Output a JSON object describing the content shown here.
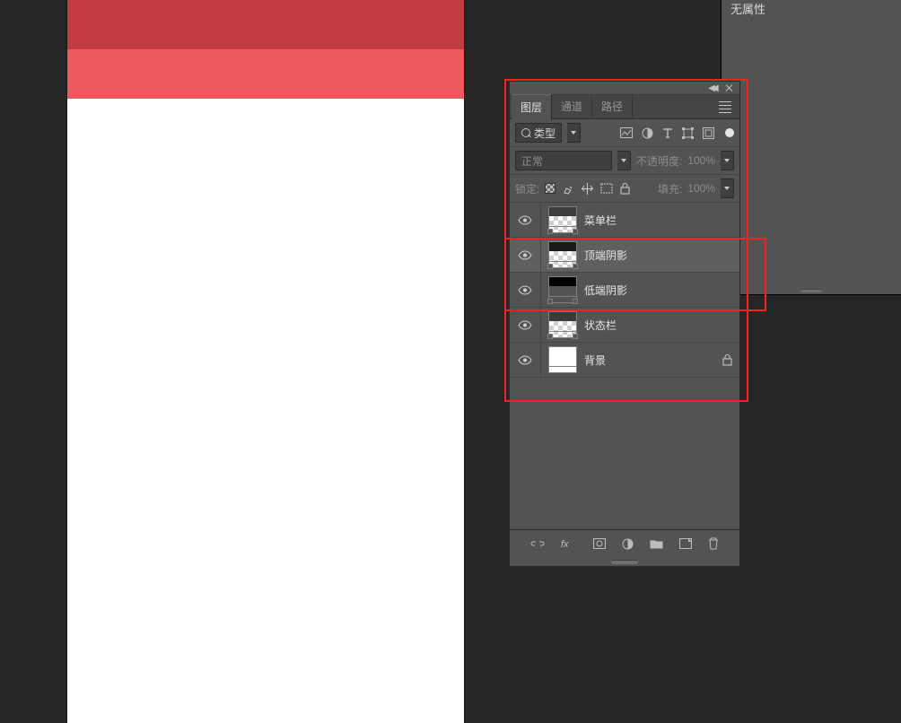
{
  "props": {
    "title": "无属性"
  },
  "tabs": {
    "layers": "图层",
    "channels": "通道",
    "paths": "路径"
  },
  "filter": {
    "kind_label": "类型"
  },
  "blend": {
    "mode": "正常",
    "opacity_label": "不透明度:",
    "opacity_value": "100%"
  },
  "lock": {
    "label": "锁定:",
    "fill_label": "填充:",
    "fill_value": "100%"
  },
  "layers": [
    {
      "name": "菜单栏",
      "thumb": "transp",
      "selected": false,
      "locked": false
    },
    {
      "name": "顶端阴影",
      "thumb": "dark",
      "selected": true,
      "locked": false
    },
    {
      "name": "低端阴影",
      "thumb": "darker",
      "selected": false,
      "locked": false
    },
    {
      "name": "状态栏",
      "thumb": "transp",
      "selected": false,
      "locked": false
    },
    {
      "name": "背景",
      "thumb": "white",
      "selected": false,
      "locked": true
    }
  ]
}
